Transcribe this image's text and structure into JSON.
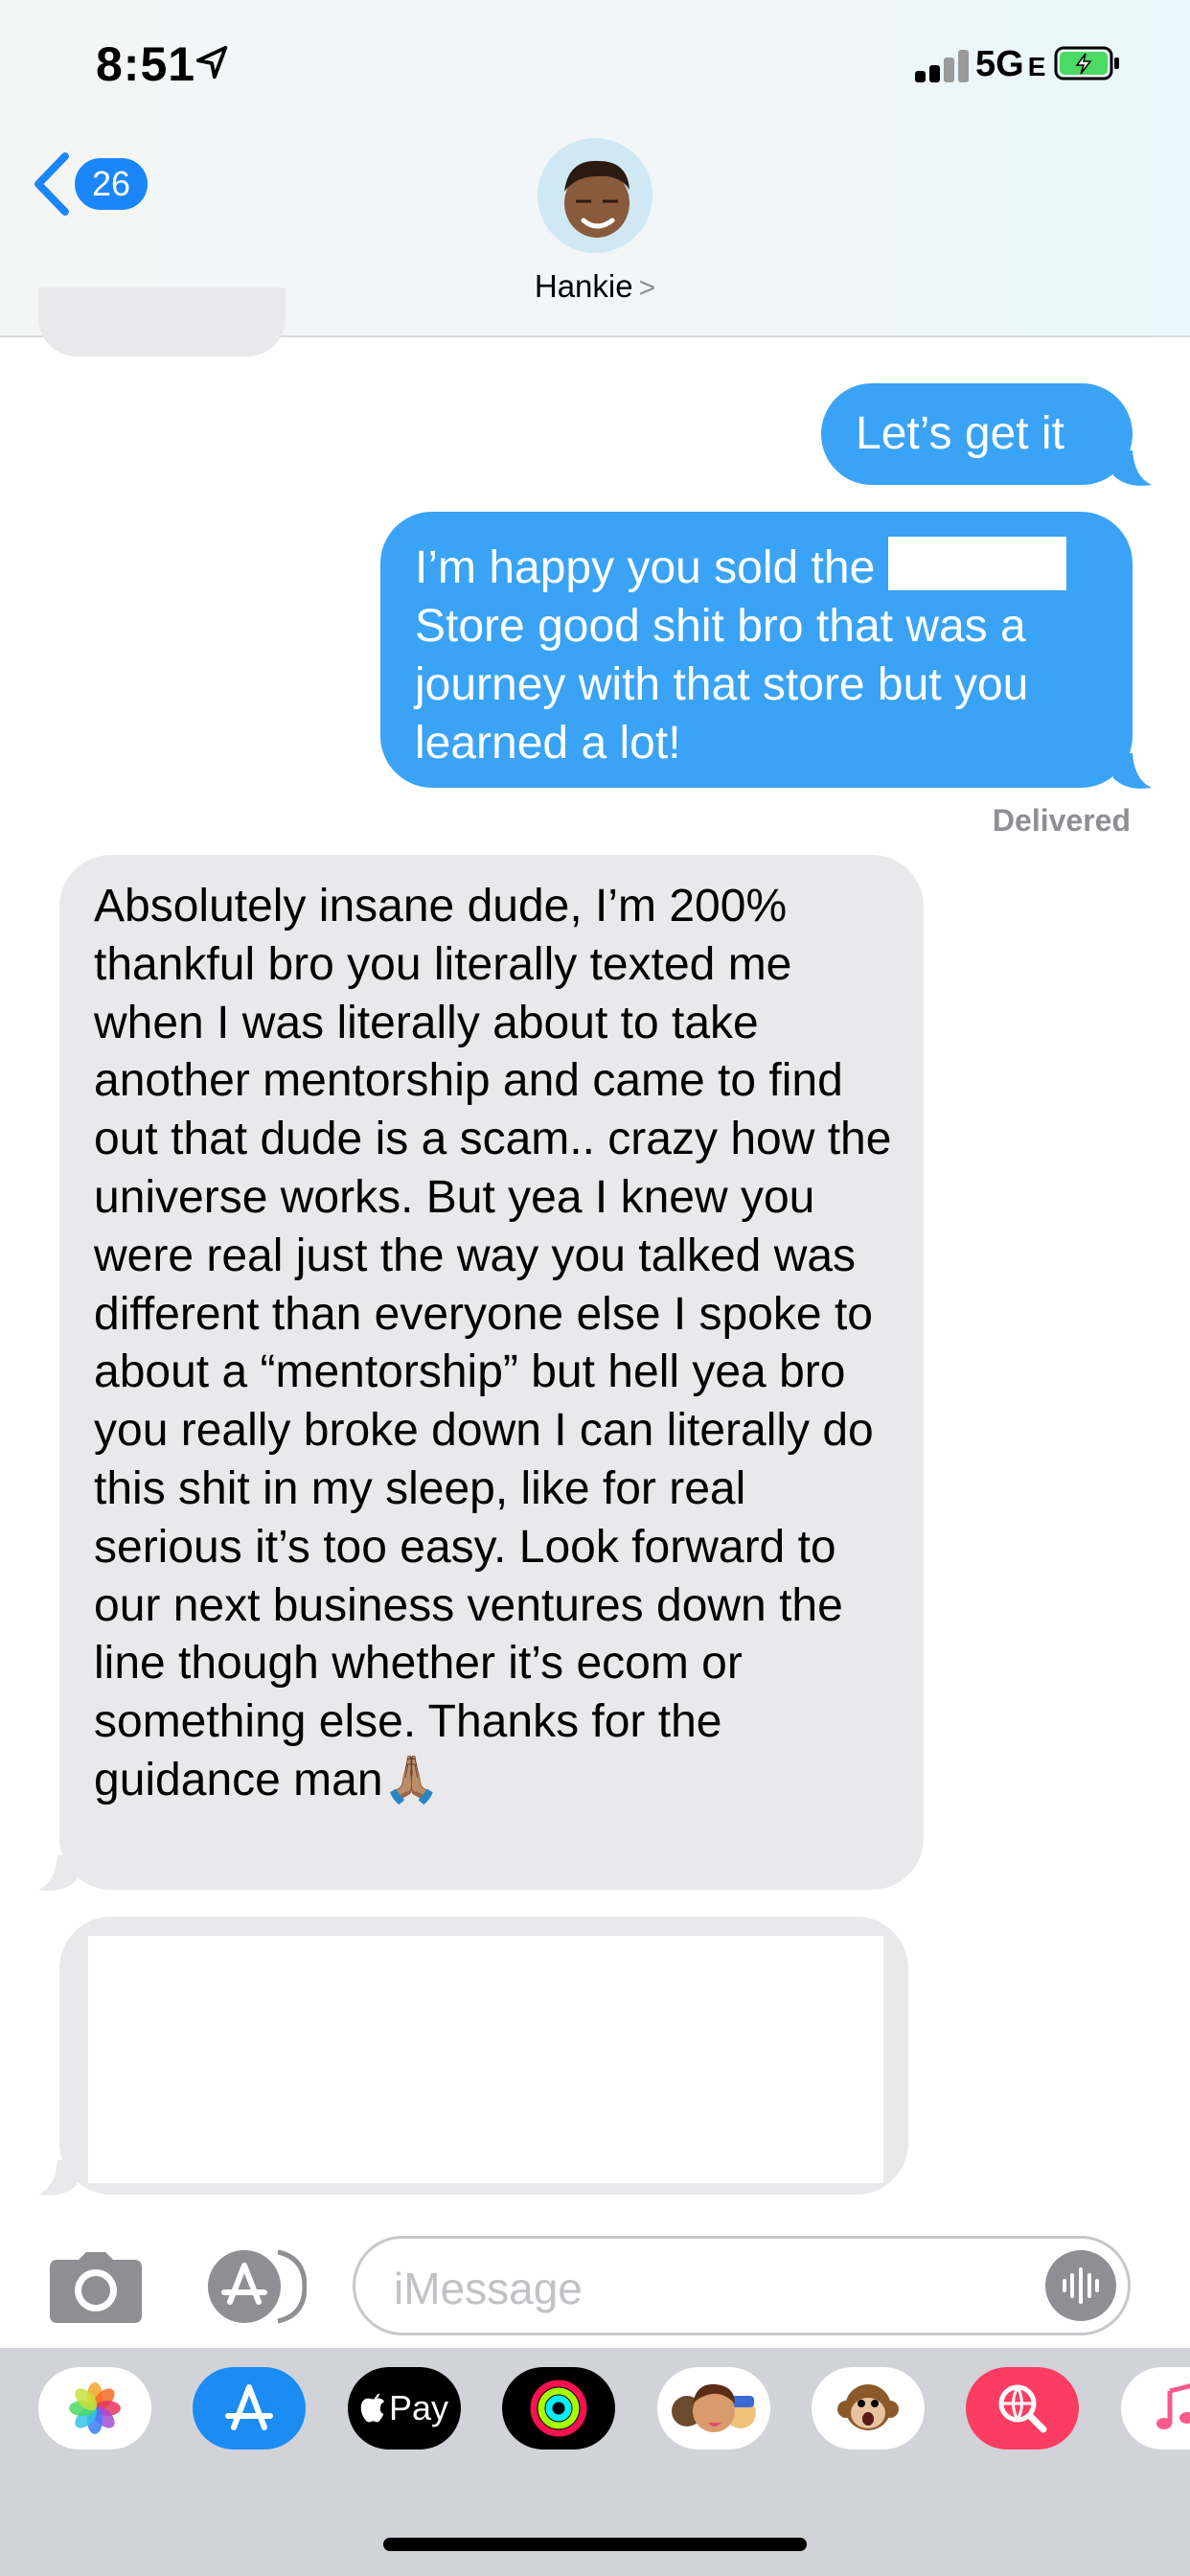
{
  "status_bar": {
    "time": "8:51",
    "network": "5G",
    "network_suffix": "E"
  },
  "nav": {
    "back_count": "26",
    "contact_name": "Hankie",
    "contact_chevron": ">"
  },
  "messages": [
    {
      "direction": "outgoing",
      "text": "Let’s get it"
    },
    {
      "direction": "outgoing",
      "text_before_redaction": "I’m happy you sold the ",
      "text_after_redaction": "Store good shit bro that was a journey with that store but you learned a lot!"
    },
    {
      "direction": "incoming",
      "text": "Absolutely insane dude, I’m 200% thankful bro you literally texted me when I was literally about to take another mentorship and came to find out that dude is a scam.. crazy how the universe works. But yea I knew you were real just the way you talked was different than everyone else I spoke to about a “mentorship” but hell yea bro you really broke down I can literally do this shit in my sleep, like for real serious it’s too easy. Look forward to our next business ventures down the line though whether it’s ecom or something else. Thanks for the guidance man🙏🏽"
    }
  ],
  "delivery_status": "Delivered",
  "composer": {
    "placeholder": "iMessage"
  },
  "app_drawer": {
    "apple_pay_label": "Pay",
    "apps": [
      "photos-app",
      "app-store-app",
      "apple-pay-app",
      "activity-app",
      "memoji-app",
      "animoji-app",
      "search-images-app",
      "music-app"
    ]
  },
  "colors": {
    "outgoing_bubble": "#3aa3f5",
    "incoming_bubble": "#e9e9eb",
    "ios_blue": "#1b86f7",
    "battery_green": "#4cd964"
  }
}
